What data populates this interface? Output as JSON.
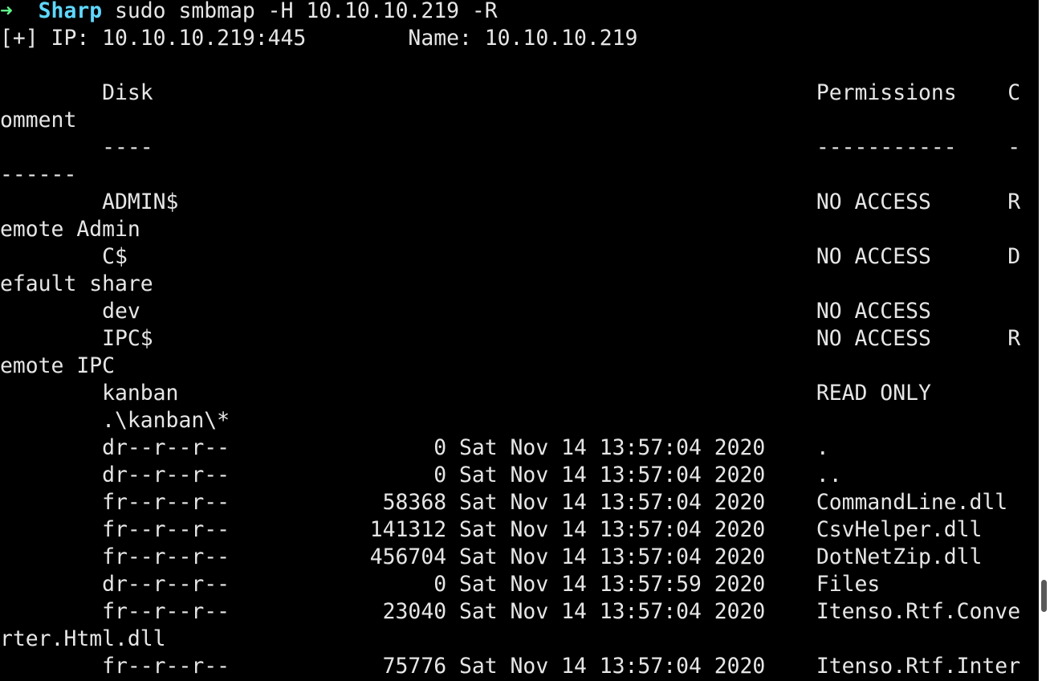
{
  "prompt": {
    "arrow": "➜",
    "cwd": "Sharp",
    "command": "sudo smbmap -H 10.10.10.219 -R"
  },
  "output": [
    "[+] IP: 10.10.10.219:445        Name: 10.10.10.219",
    "",
    "        Disk                                                    Permissions    C",
    "omment",
    "        ----                                                    -----------    -",
    "------",
    "        ADMIN$                                                  NO ACCESS      R",
    "emote Admin",
    "        C$                                                      NO ACCESS      D",
    "efault share",
    "        dev                                                     NO ACCESS",
    "        IPC$                                                    NO ACCESS      R",
    "emote IPC",
    "        kanban                                                  READ ONLY",
    "        .\\kanban\\*",
    "        dr--r--r--                0 Sat Nov 14 13:57:04 2020    .",
    "        dr--r--r--                0 Sat Nov 14 13:57:04 2020    ..",
    "        fr--r--r--            58368 Sat Nov 14 13:57:04 2020    CommandLine.dll",
    "        fr--r--r--           141312 Sat Nov 14 13:57:04 2020    CsvHelper.dll",
    "        fr--r--r--           456704 Sat Nov 14 13:57:04 2020    DotNetZip.dll",
    "        dr--r--r--                0 Sat Nov 14 13:57:59 2020    Files",
    "        fr--r--r--            23040 Sat Nov 14 13:57:04 2020    Itenso.Rtf.Conve",
    "rter.Html.dll",
    "        fr--r--r--            75776 Sat Nov 14 13:57:04 2020    Itenso.Rtf.Inter"
  ]
}
